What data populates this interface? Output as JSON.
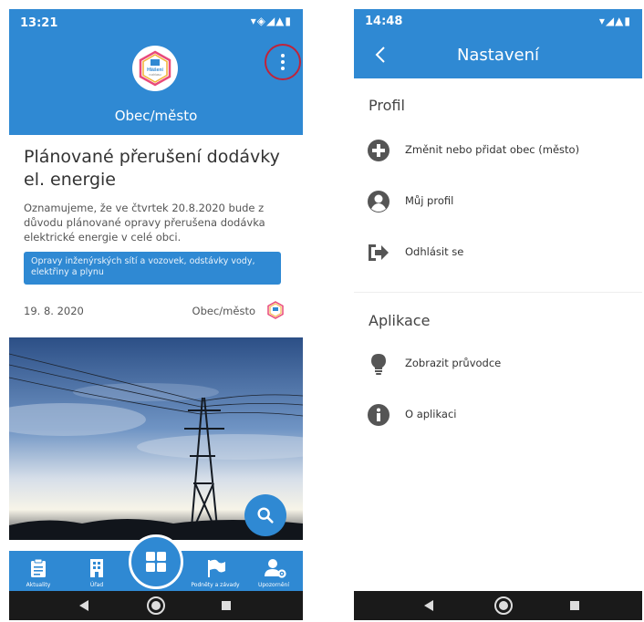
{
  "left": {
    "status": {
      "time": "13:21",
      "icons": "▾◈◢▲▮"
    },
    "header": {
      "city": "Obec/město",
      "logo_text_1": "Hlášení",
      "logo_text_2": "rozhlasu"
    },
    "news": {
      "title": "Plánované přerušení dodávky el. energie",
      "body": "Oznamujeme, že ve čtvrtek 20.8.2020 bude z důvodu plánované opravy přerušena dodávka elektrické energie v celé obci.",
      "tag": "Opravy inženýrských sítí a vozovek, odstávky vody, elektřiny a plynu",
      "date": "19. 8. 2020",
      "source": "Obec/město"
    },
    "bottom_nav": {
      "items": [
        {
          "label": "Aktuality",
          "icon": "clipboard-icon"
        },
        {
          "label": "Úřad",
          "icon": "building-icon"
        },
        {
          "label": "Podněty a závady",
          "icon": "flag-icon"
        },
        {
          "label": "Upozornění",
          "icon": "user-settings-icon"
        }
      ],
      "center_icon": "grid-icon"
    }
  },
  "right": {
    "status": {
      "time": "14:48",
      "icons": "▾◢▲▮"
    },
    "header": {
      "title": "Nastavení"
    },
    "sections": [
      {
        "title": "Profil",
        "items": [
          {
            "label": "Změnit nebo přidat obec (město)",
            "icon": "plus-circle-icon"
          },
          {
            "label": "Můj profil",
            "icon": "user-circle-icon"
          },
          {
            "label": "Odhlásit se",
            "icon": "logout-icon"
          }
        ]
      },
      {
        "title": "Aplikace",
        "items": [
          {
            "label": "Zobrazit průvodce",
            "icon": "lightbulb-icon"
          },
          {
            "label": "O aplikaci",
            "icon": "info-circle-icon"
          }
        ]
      }
    ]
  },
  "colors": {
    "primary": "#2f89d3",
    "accent_ring": "#c0233a",
    "nav_dark": "#1a1a1a",
    "text": "#333333"
  }
}
